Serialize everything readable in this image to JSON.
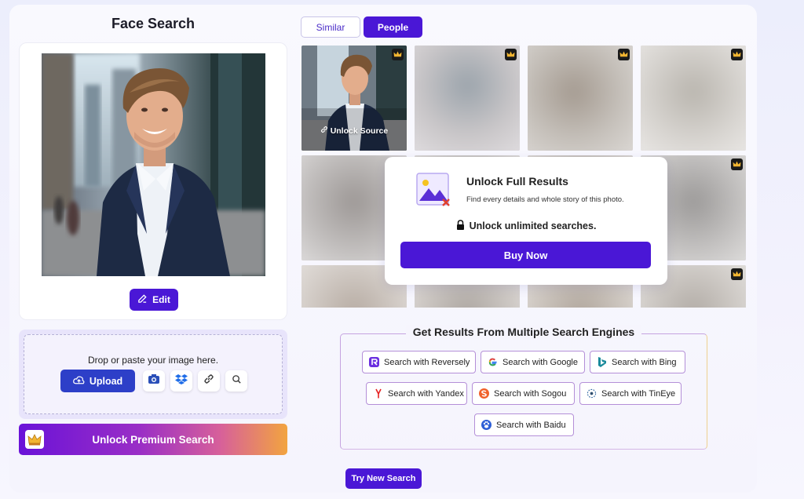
{
  "page_title": "Face Search",
  "photo_card": {
    "edit_label": "Edit"
  },
  "upload": {
    "drop_text": "Drop or paste your image here.",
    "upload_label": "Upload",
    "tools": [
      "camera-icon",
      "dropbox-icon",
      "link-icon",
      "search-icon"
    ]
  },
  "premium": {
    "label": "Unlock Premium Search"
  },
  "tabs": {
    "similar": "Similar",
    "people": "People",
    "active": "People"
  },
  "results": {
    "first_tile_label": "Unlock Source"
  },
  "unlock_modal": {
    "title": "Unlock Full Results",
    "subtitle": "Find every details and whole story of this photo.",
    "limit_text": "Unlock unlimited searches.",
    "buy_label": "Buy Now"
  },
  "engines": {
    "title": "Get Results From Multiple Search Engines",
    "items": [
      {
        "label": "Search with Reversely",
        "icon": "reversely-icon"
      },
      {
        "label": "Search with Google",
        "icon": "google-icon"
      },
      {
        "label": "Search with Bing",
        "icon": "bing-icon"
      },
      {
        "label": "Search with Yandex",
        "icon": "yandex-icon"
      },
      {
        "label": "Search with Sogou",
        "icon": "sogou-icon"
      },
      {
        "label": "Search with TinEye",
        "icon": "tineye-icon"
      },
      {
        "label": "Search with Baidu",
        "icon": "baidu-icon"
      }
    ]
  },
  "try_new_label": "Try New Search",
  "colors": {
    "accent": "#4a17d6",
    "upload_blue": "#2d3fc8",
    "premium_start": "#6a12d8",
    "premium_end": "#f2a43f"
  }
}
